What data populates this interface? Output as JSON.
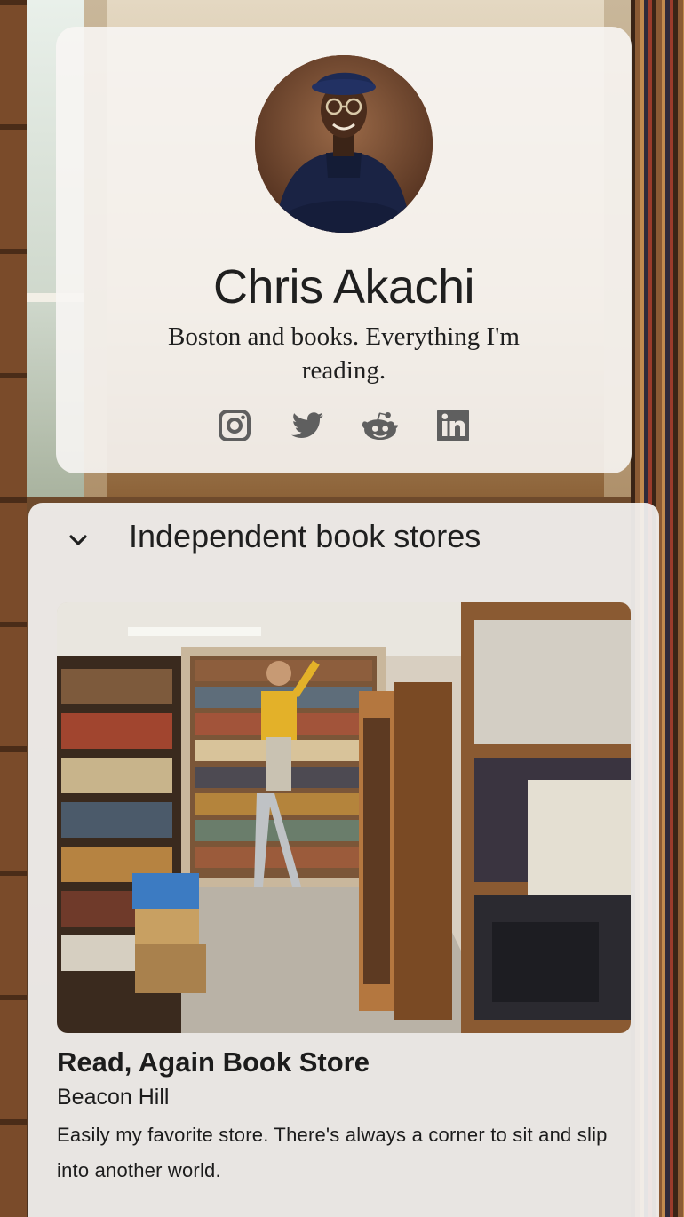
{
  "profile": {
    "name": "Chris Akachi",
    "bio": "Boston and books. Everything I'm reading.",
    "avatar_alt": "avatar",
    "social_links": [
      {
        "icon": "instagram-icon"
      },
      {
        "icon": "twitter-icon"
      },
      {
        "icon": "reddit-icon"
      },
      {
        "icon": "linkedin-icon"
      }
    ]
  },
  "collection": {
    "title": "Independent book stores",
    "expanded": true,
    "item": {
      "name": "Read, Again Book Store",
      "location": "Beacon Hill",
      "description": "Easily my favorite store. There's always a corner to sit and slip into another world."
    }
  },
  "colors": {
    "card_bg": "#f7f5f3",
    "text": "#1f1f1f",
    "icon": "#5f5f5f"
  }
}
